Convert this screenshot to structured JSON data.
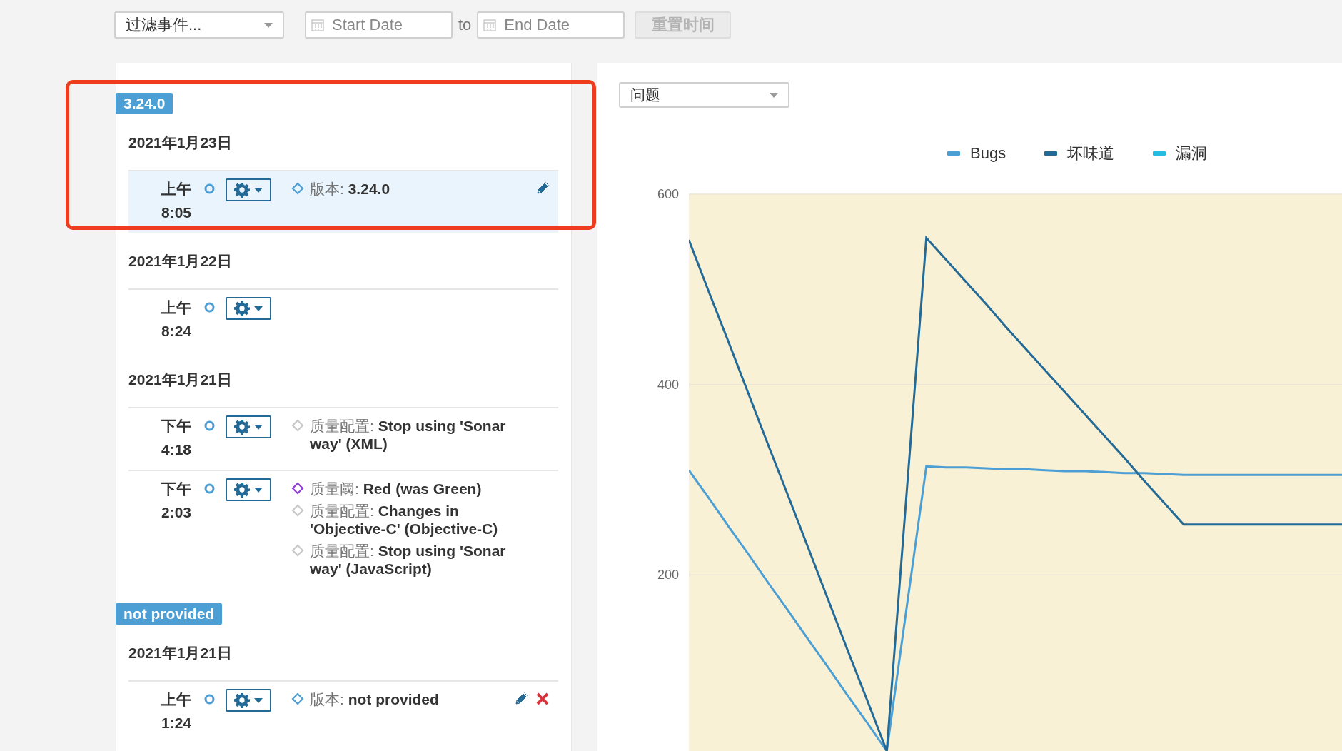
{
  "toolbar": {
    "event_filter": {
      "value": "过滤事件..."
    },
    "start_date": {
      "placeholder": "Start Date"
    },
    "range_separator": "to",
    "end_date": {
      "placeholder": "End Date"
    },
    "reset_button": {
      "label": "重置时间",
      "disabled": true
    }
  },
  "timeline": [
    {
      "version": "3.24.0",
      "highlighted": true,
      "days": [
        {
          "date": "2021年1月23日",
          "events": [
            {
              "time": "上午 8:05",
              "selected": true,
              "editable": true,
              "deletable": false,
              "items": [
                {
                  "kind": "version",
                  "category": "版本:",
                  "value": "3.24.0"
                }
              ]
            }
          ]
        },
        {
          "date": "2021年1月22日",
          "events": [
            {
              "time": "上午 8:24",
              "selected": false,
              "editable": false,
              "deletable": false
            }
          ]
        },
        {
          "date": "2021年1月21日",
          "events": [
            {
              "time": "下午 4:18",
              "selected": false,
              "editable": false,
              "deletable": false,
              "items": [
                {
                  "kind": "profile",
                  "category": "质量配置:",
                  "value": "Stop using 'Sonar way' (XML)"
                }
              ]
            },
            {
              "time": "下午 2:03",
              "selected": false,
              "editable": false,
              "deletable": false,
              "items": [
                {
                  "kind": "gate",
                  "category": "质量阈:",
                  "value": "Red (was Green)"
                },
                {
                  "kind": "profile",
                  "category": "质量配置:",
                  "value": "Changes in 'Objective-C' (Objective-C)"
                },
                {
                  "kind": "profile",
                  "category": "质量配置:",
                  "value": "Stop using 'Sonar way' (JavaScript)"
                }
              ]
            }
          ]
        }
      ]
    },
    {
      "version": "not provided",
      "highlighted": false,
      "days": [
        {
          "date": "2021年1月21日",
          "events": [
            {
              "time": "上午 1:24",
              "selected": false,
              "editable": true,
              "deletable": true,
              "items": [
                {
                  "kind": "version",
                  "category": "版本:",
                  "value": "not provided"
                }
              ]
            }
          ]
        }
      ]
    }
  ],
  "graph": {
    "metric_select": {
      "value": "问题"
    },
    "chart_data": {
      "type": "line",
      "categories": [
        null,
        null,
        null,
        null,
        null,
        null,
        null,
        null,
        null,
        null,
        null,
        null,
        null,
        null,
        null,
        null,
        null,
        null,
        null,
        null,
        null,
        null,
        null,
        null,
        null,
        null,
        null,
        null,
        null,
        null,
        null,
        null,
        null,
        null
      ],
      "ylim": [
        15,
        600
      ],
      "yticks": [
        200,
        400,
        600
      ],
      "series": [
        {
          "name": "Bugs",
          "color": "#4b9fd5",
          "values": [
            310,
            281,
            251,
            222,
            192,
            163,
            133,
            104,
            74,
            45,
            15,
            165,
            314,
            313,
            313,
            312,
            311,
            311,
            310,
            309,
            309,
            308,
            307,
            307,
            306,
            305,
            305,
            305,
            305,
            305,
            305,
            305,
            305,
            305
          ]
        },
        {
          "name": "坏味道",
          "color": "#236a97",
          "values": [
            552,
            498,
            445,
            391,
            337,
            284,
            230,
            176,
            122,
            69,
            15,
            285,
            554,
            531,
            508,
            485,
            461,
            438,
            415,
            392,
            369,
            346,
            323,
            299,
            276,
            253,
            253,
            253,
            253,
            253,
            253,
            253,
            253,
            253
          ]
        },
        {
          "name": "漏洞",
          "color": "#24bce0",
          "values": [
            null,
            null,
            null,
            null,
            null,
            null,
            null,
            null,
            null,
            null,
            null,
            null,
            null,
            null,
            null,
            null,
            null,
            null,
            null,
            null,
            null,
            null,
            null,
            null,
            null,
            null,
            null,
            null,
            null,
            null,
            null,
            null,
            null,
            null
          ]
        }
      ]
    }
  }
}
